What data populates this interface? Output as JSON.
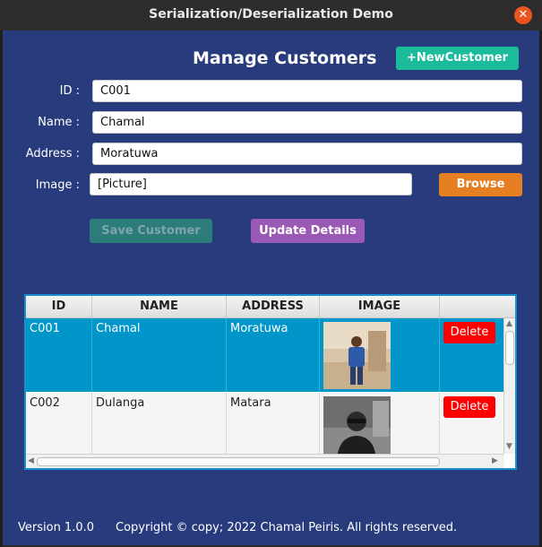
{
  "window": {
    "title": "Serialization/Deserialization Demo",
    "minimize_glyph": "–",
    "close_glyph": "✕"
  },
  "form": {
    "heading": "Manage Customers",
    "new_button": "+NewCustomer",
    "id_label": "ID :",
    "id_value": "C001",
    "name_label": "Name :",
    "name_value": "Chamal",
    "address_label": "Address :",
    "address_value": "Moratuwa",
    "image_label": "Image :",
    "image_value": "[Picture]",
    "browse_button": "Browse",
    "save_button": "Save Customer",
    "update_button": "Update Details"
  },
  "table": {
    "columns": [
      "ID",
      "NAME",
      "ADDRESS",
      "IMAGE",
      ""
    ],
    "rows": [
      {
        "id": "C001",
        "name": "Chamal",
        "address": "Moratuwa",
        "delete": "Delete",
        "selected": true
      },
      {
        "id": "C002",
        "name": "Dulanga",
        "address": "Matara",
        "delete": "Delete",
        "selected": false
      }
    ]
  },
  "footer": {
    "version": "Version 1.0.0",
    "copyright": "Copyright © copy; 2022 Chamal Peiris. All rights reserved."
  },
  "colors": {
    "background": "#283b7c",
    "accent_green": "#1abc9c",
    "accent_orange": "#e67e22",
    "accent_purple": "#9b59b6",
    "selection": "#0096c9",
    "delete_red": "#ff0000"
  }
}
